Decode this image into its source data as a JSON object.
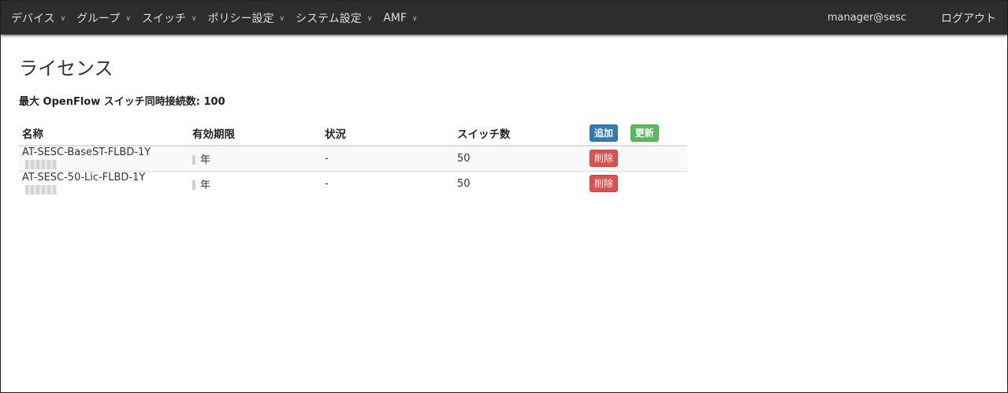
{
  "nav": {
    "items": [
      {
        "label": "デバイス"
      },
      {
        "label": "グループ"
      },
      {
        "label": "スイッチ"
      },
      {
        "label": "ポリシー設定"
      },
      {
        "label": "システム設定"
      },
      {
        "label": "AMF"
      }
    ],
    "user": "manager@sesc",
    "logout": "ログアウト"
  },
  "page": {
    "title": "ライセンス",
    "max_connections": "最大 OpenFlow スイッチ同時接続数: 100"
  },
  "table": {
    "headers": {
      "name": "名称",
      "expiry": "有効期限",
      "status": "状況",
      "switch_count": "スイッチ数",
      "add_button": "追加",
      "update_button": "更新"
    },
    "rows": [
      {
        "name": "AT-SESC-BaseST-FLBD-1Y",
        "expiry": "年",
        "status": "-",
        "switch_count": "50",
        "delete": "削除"
      },
      {
        "name": "AT-SESC-50-Lic-FLBD-1Y",
        "expiry": "年",
        "status": "-",
        "switch_count": "50",
        "delete": "削除"
      }
    ]
  },
  "colors": {
    "navbar": "#2d2d2d",
    "primary": "#337ab7",
    "success": "#5cb85c",
    "danger": "#d9534f"
  }
}
